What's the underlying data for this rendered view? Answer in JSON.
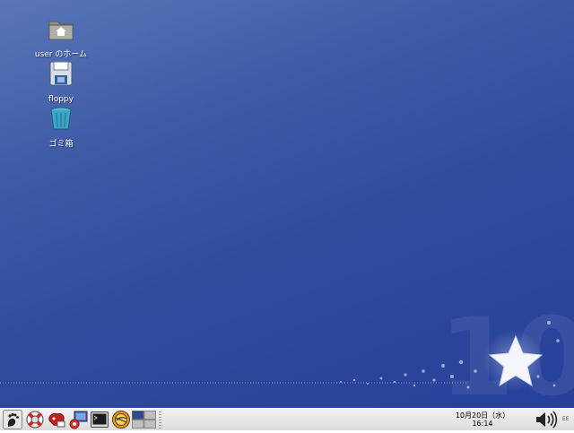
{
  "desktop": {
    "icons": [
      {
        "label": "user のホーム",
        "icon": "home-folder-icon"
      },
      {
        "label": "floppy",
        "icon": "floppy-disk-icon"
      },
      {
        "label": "ゴミ箱",
        "icon": "trash-icon"
      }
    ],
    "wallpaper": {
      "watermark": "10",
      "colors": {
        "top": "#5a76b8",
        "bottom": "#27409a"
      }
    }
  },
  "panel": {
    "launchers": [
      {
        "name": "main-menu-foot-icon"
      },
      {
        "name": "help-lifebuoy-icon"
      },
      {
        "name": "mail-icon"
      },
      {
        "name": "network-computer-icon"
      },
      {
        "name": "terminal-icon"
      },
      {
        "name": "web-browser-icon"
      },
      {
        "name": "workspace-switcher-icon"
      }
    ],
    "clock": {
      "date": "10月20日（水）",
      "time": "16:14"
    },
    "volume_icon": "speaker-volume-icon",
    "keyboard_indicator": "EE"
  }
}
